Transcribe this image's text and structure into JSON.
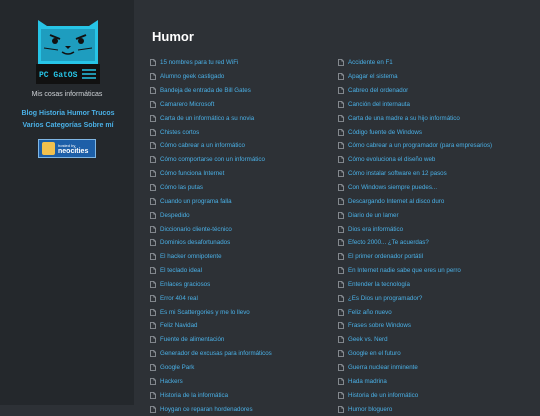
{
  "sidebar": {
    "logo_text": "PC GatOS",
    "tagline": "Mis cosas informáticas",
    "nav": [
      "Blog",
      "Historia",
      "Humor",
      "Trucos",
      "Varios",
      "Categorías",
      "Sobre mí"
    ],
    "badge": {
      "small": "hosted by",
      "big": "neocities"
    }
  },
  "main": {
    "title": "Humor",
    "col1": [
      "15 nombres para tu red WiFi",
      "Alumno geek castigado",
      "Bandeja de entrada de Bill Gates",
      "Camarero Microsoft",
      "Carta de un informático a su novia",
      "Chistes cortos",
      "Cómo cabrear a un informático",
      "Cómo comportarse con un informático",
      "Cómo funciona Internet",
      "Cómo las putas",
      "Cuando un programa falla",
      "Despedido",
      "Diccionario cliente-técnico",
      "Dominios desafortunados",
      "El hacker omnipotente",
      "El teclado ideal",
      "Enlaces graciosos",
      "Error 404 real",
      "Es mi Scattergories y me lo llevo",
      "Feliz Navidad",
      "Fuente de alimentación",
      "Generador de excusas para informáticos",
      "Google Park",
      "Hackers",
      "Historia de la informática",
      "Hoygan ce reparan hordenadores"
    ],
    "col2": [
      "Accidente en F1",
      "Apagar el sistema",
      "Cabreo del ordenador",
      "Canción del internauta",
      "Carta de una madre a su hijo informático",
      "Código fuente de Windows",
      "Cómo cabrear a un programador (para empresarios)",
      "Cómo evoluciona el diseño web",
      "Cómo instalar software en 12 pasos",
      "Con Windows siempre puedes...",
      "Descargando Internet al disco duro",
      "Diario de un lamer",
      "Dios era informático",
      "Efecto 2000... ¿Te acuerdas?",
      "El primer ordenador portátil",
      "En Internet nadie sabe que eres un perro",
      "Entender la tecnología",
      "¿Es Dios un programador?",
      "Feliz año nuevo",
      "Frases sobre Windows",
      "Geek vs. Nerd",
      "Google en el futuro",
      "Guerra nuclear inminente",
      "Hada madrina",
      "Historia de un informático",
      "Humor bloguero"
    ]
  },
  "colors": {
    "background": "#2d3136",
    "sidebar": "#24282c",
    "link": "#4ab0e6",
    "logo_cyan": "#27c4e6"
  }
}
